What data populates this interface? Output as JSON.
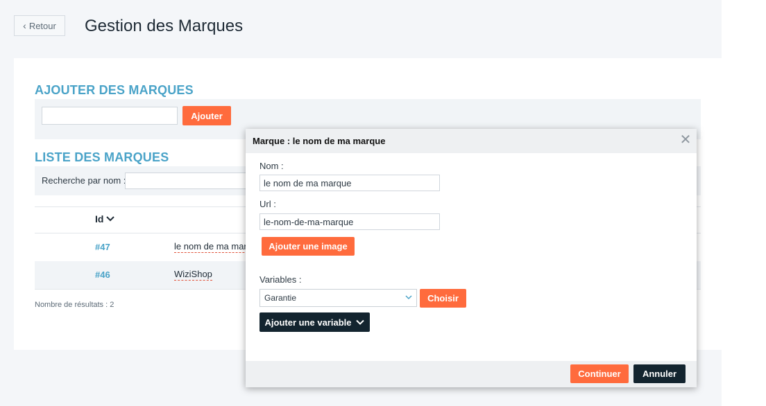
{
  "header": {
    "back_label": "Retour",
    "title": "Gestion des Marques"
  },
  "add_section": {
    "title": "AJOUTER DES MARQUES",
    "input_value": "",
    "button_label": "Ajouter"
  },
  "list_section": {
    "title": "LISTE DES MARQUES",
    "search_label": "Recherche par nom :",
    "search_value": "",
    "columns": {
      "id": "Id"
    },
    "rows": [
      {
        "id": "#47",
        "name": "le nom de ma marque"
      },
      {
        "id": "#46",
        "name": "WiziShop"
      }
    ],
    "results_text": "Nombre de résultats : 2"
  },
  "modal": {
    "title": "Marque : le nom de ma marque",
    "close_icon": "close-icon",
    "nom_label": "Nom :",
    "nom_value": "le nom de ma marque",
    "url_label": "Url :",
    "url_value": "le-nom-de-ma-marque",
    "add_image_label": "Ajouter une image",
    "variables_label": "Variables :",
    "variable_selected": "Garantie",
    "choose_label": "Choisir",
    "add_variable_label": "Ajouter une variable",
    "continue_label": "Continuer",
    "cancel_label": "Annuler"
  },
  "colors": {
    "accent_orange": "#ff6b3d",
    "accent_blue": "#4aa3c8",
    "dark_navy": "#13242f"
  }
}
